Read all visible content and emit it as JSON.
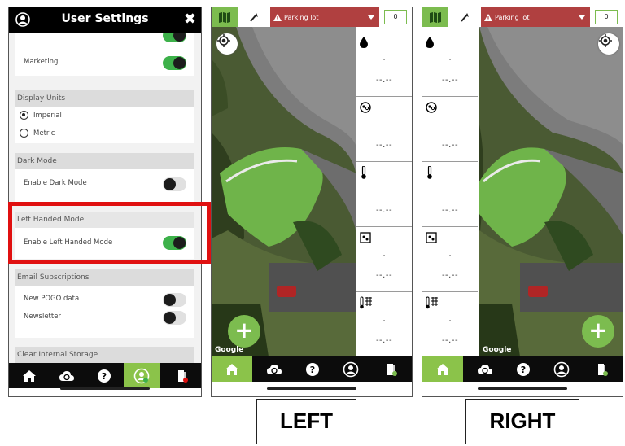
{
  "settings": {
    "title": "User Settings",
    "close_glyph": "✖",
    "marketing_label": "Marketing",
    "marketing_on": true,
    "display_units": {
      "header": "Display Units",
      "options": [
        {
          "label": "Imperial",
          "selected": true
        },
        {
          "label": "Metric",
          "selected": false
        }
      ]
    },
    "dark_mode": {
      "header": "Dark Mode",
      "label": "Enable Dark Mode",
      "on": false
    },
    "left_handed": {
      "header": "Left Handed Mode",
      "label": "Enable Left Handed Mode",
      "on": true
    },
    "email": {
      "header": "Email Subscriptions",
      "items": [
        {
          "label": "New POGO data",
          "on": false
        },
        {
          "label": "Newsletter",
          "on": false
        }
      ]
    },
    "storage_header": "Clear Internal Storage"
  },
  "nav": {
    "items": [
      "home-icon",
      "cloud-sync-icon",
      "help-icon",
      "user-settings-icon",
      "logout-icon"
    ],
    "active_settings": 3,
    "active_map": 0
  },
  "map_topbar": {
    "alert_label": "Parking lot",
    "count": "0"
  },
  "readings": [
    {
      "icon": "water-drop-icon",
      "dot": ".",
      "value": "--.--"
    },
    {
      "icon": "soil-sensor-icon",
      "dot": ".",
      "value": "--.--"
    },
    {
      "icon": "thermometer-icon",
      "dot": ".",
      "value": "--.--"
    },
    {
      "icon": "salinity-icon",
      "dot": ".",
      "value": "--.--"
    },
    {
      "icon": "temperature-grid-icon",
      "dot": ".",
      "value": "--.--"
    }
  ],
  "map_attribution": "Google",
  "fab_label": "+",
  "captions": {
    "left": "LEFT",
    "right": "RIGHT"
  },
  "colors": {
    "accent": "#7cbc4f",
    "alert": "#b04040",
    "highlight": "#e01010"
  }
}
